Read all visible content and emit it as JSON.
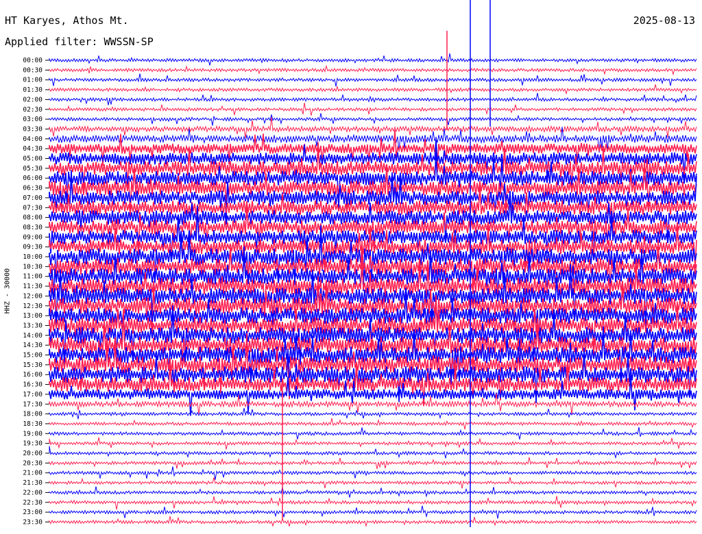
{
  "header": {
    "station": "HT Karyes, Athos Mt.",
    "date": "2025-08-13",
    "filter_label": "Applied filter: WWSSN-SP"
  },
  "chart_data": {
    "type": "line",
    "title": "HT Karyes, Athos Mt.",
    "ylabel": "HHZ - 30000",
    "xlabel": "",
    "grid": false,
    "colors": [
      "#0000ff",
      "#ff2050"
    ],
    "row_labels": [
      "00:00",
      "00:30",
      "01:00",
      "01:30",
      "02:00",
      "02:30",
      "03:00",
      "03:30",
      "04:00",
      "04:30",
      "05:00",
      "05:30",
      "06:00",
      "06:30",
      "07:00",
      "07:30",
      "08:00",
      "08:30",
      "09:00",
      "09:30",
      "10:00",
      "10:30",
      "11:00",
      "11:30",
      "12:00",
      "12:30",
      "13:00",
      "13:30",
      "14:00",
      "14:30",
      "15:00",
      "15:30",
      "16:00",
      "16:30",
      "17:00",
      "17:30",
      "18:00",
      "18:30",
      "19:00",
      "19:30",
      "20:00",
      "20:30",
      "21:00",
      "21:30",
      "22:00",
      "22:30",
      "23:00",
      "23:30"
    ],
    "noise_level": [
      1,
      1,
      1,
      1,
      1,
      1,
      1,
      2,
      3,
      4,
      5,
      6,
      6,
      6,
      6,
      6,
      6,
      6,
      6,
      6,
      7,
      7,
      7,
      7,
      7,
      7,
      7,
      7,
      7,
      7,
      7,
      7,
      7,
      6,
      4,
      2,
      1,
      1,
      1,
      1,
      1,
      1,
      1,
      1,
      1,
      1,
      1,
      1
    ]
  }
}
